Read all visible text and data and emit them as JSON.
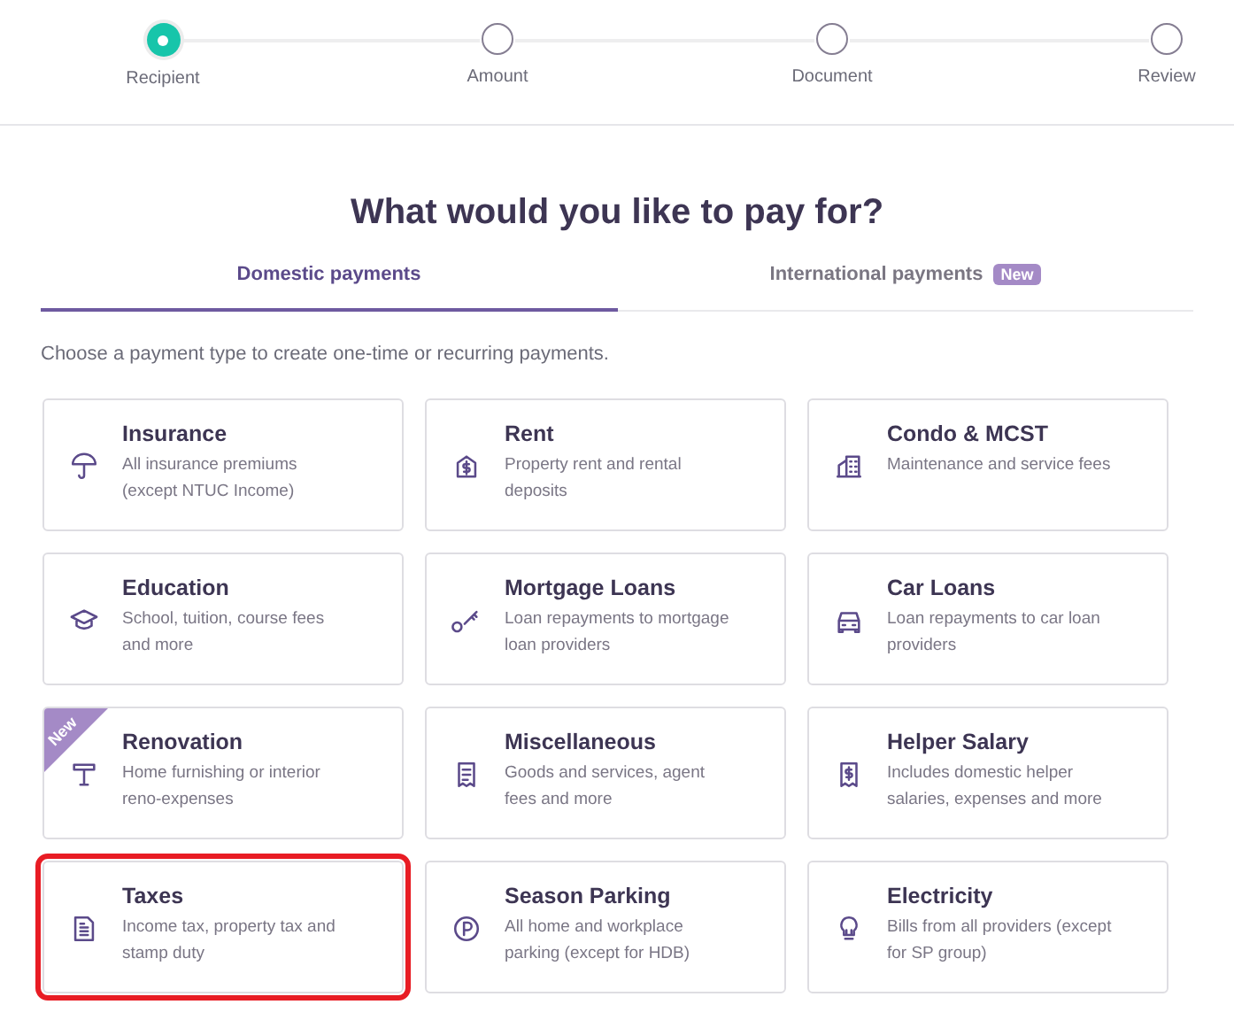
{
  "steps": [
    {
      "label": "Recipient",
      "selected": true
    },
    {
      "label": "Amount",
      "selected": false
    },
    {
      "label": "Document",
      "selected": false
    },
    {
      "label": "Review",
      "selected": false
    }
  ],
  "title": "What would you like to pay for?",
  "tabs": [
    {
      "label": "Domestic payments",
      "selected": true
    },
    {
      "label": "International payments",
      "selected": false,
      "badge": "New"
    }
  ],
  "intro": "Choose a payment type to create one-time or recurring payments.",
  "payment_types": [
    {
      "title": "Insurance",
      "description": "All insurance premiums (except NTUC Income)",
      "highlighted": false
    },
    {
      "title": "Rent",
      "description": "Property rent and rental deposits",
      "highlighted": false
    },
    {
      "title": "Condo & MCST",
      "description": "Maintenance and service fees",
      "highlighted": false
    },
    {
      "title": "Education",
      "description": "School, tuition, course fees and more",
      "highlighted": false
    },
    {
      "title": "Mortgage Loans",
      "description": "Loan repayments to mortgage loan providers",
      "highlighted": false
    },
    {
      "title": "Car Loans",
      "description": "Loan repayments to car loan providers",
      "highlighted": false
    },
    {
      "title": "Renovation",
      "description": "Home furnishing or interior reno-expenses",
      "highlighted": false,
      "badge": "New"
    },
    {
      "title": "Miscellaneous",
      "description": "Goods and services, agent fees and more",
      "highlighted": false
    },
    {
      "title": "Helper Salary",
      "description": "Includes domestic helper salaries, expenses and more",
      "highlighted": false
    },
    {
      "title": "Taxes",
      "description": "Income tax, property tax and stamp duty",
      "highlighted": true
    },
    {
      "title": "Season Parking",
      "description": "All home and workplace parking (except for HDB)",
      "highlighted": false
    },
    {
      "title": "Electricity",
      "description": "Bills from all providers (except for SP group)",
      "highlighted": false
    }
  ]
}
